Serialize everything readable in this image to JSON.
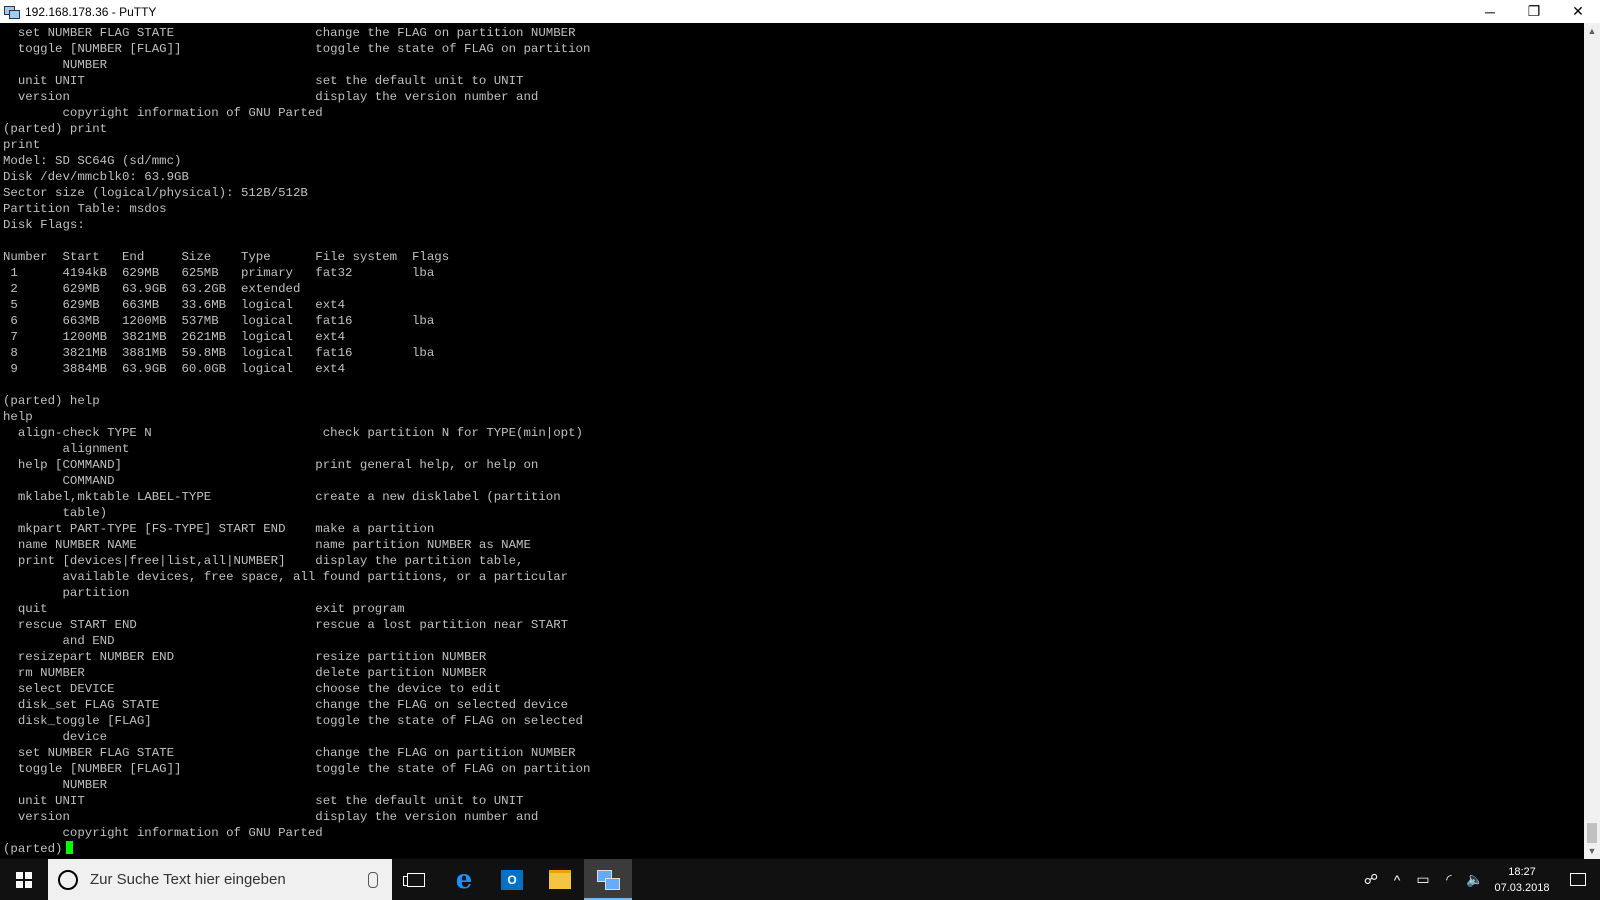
{
  "window": {
    "title": "192.168.178.36 - PuTTY",
    "controls": {
      "minimize": "─",
      "maximize": "❐",
      "close": "✕"
    }
  },
  "terminal": {
    "lines": [
      "  set NUMBER FLAG STATE                   change the FLAG on partition NUMBER",
      "  toggle [NUMBER [FLAG]]                  toggle the state of FLAG on partition",
      "        NUMBER",
      "  unit UNIT                               set the default unit to UNIT",
      "  version                                 display the version number and",
      "        copyright information of GNU Parted",
      "(parted) print",
      "print",
      "Model: SD SC64G (sd/mmc)",
      "Disk /dev/mmcblk0: 63.9GB",
      "Sector size (logical/physical): 512B/512B",
      "Partition Table: msdos",
      "Disk Flags:",
      "",
      "Number  Start   End     Size    Type      File system  Flags",
      " 1      4194kB  629MB   625MB   primary   fat32        lba",
      " 2      629MB   63.9GB  63.2GB  extended",
      " 5      629MB   663MB   33.6MB  logical   ext4",
      " 6      663MB   1200MB  537MB   logical   fat16        lba",
      " 7      1200MB  3821MB  2621MB  logical   ext4",
      " 8      3821MB  3881MB  59.8MB  logical   fat16        lba",
      " 9      3884MB  63.9GB  60.0GB  logical   ext4",
      "",
      "(parted) help",
      "help",
      "  align-check TYPE N                       check partition N for TYPE(min|opt)",
      "        alignment",
      "  help [COMMAND]                          print general help, or help on",
      "        COMMAND",
      "  mklabel,mktable LABEL-TYPE              create a new disklabel (partition",
      "        table)",
      "  mkpart PART-TYPE [FS-TYPE] START END    make a partition",
      "  name NUMBER NAME                        name partition NUMBER as NAME",
      "  print [devices|free|list,all|NUMBER]    display the partition table,",
      "        available devices, free space, all found partitions, or a particular",
      "        partition",
      "  quit                                    exit program",
      "  rescue START END                        rescue a lost partition near START",
      "        and END",
      "  resizepart NUMBER END                   resize partition NUMBER",
      "  rm NUMBER                               delete partition NUMBER",
      "  select DEVICE                           choose the device to edit",
      "  disk_set FLAG STATE                     change the FLAG on selected device",
      "  disk_toggle [FLAG]                      toggle the state of FLAG on selected",
      "        device",
      "  set NUMBER FLAG STATE                   change the FLAG on partition NUMBER",
      "  toggle [NUMBER [FLAG]]                  toggle the state of FLAG on partition",
      "        NUMBER",
      "  unit UNIT                               set the default unit to UNIT",
      "  version                                 display the version number and",
      "        copyright information of GNU Parted"
    ],
    "prompt": "(parted)",
    "colors": {
      "background": "#000000",
      "text": "#c0c0c0",
      "cursor": "#00ff00"
    }
  },
  "taskbar": {
    "search_placeholder": "Zur Suche Text hier eingeben",
    "apps": [
      {
        "name": "task-view",
        "icon": "taskview-icon"
      },
      {
        "name": "edge",
        "icon": "edge-icon",
        "glyph": "e"
      },
      {
        "name": "outlook",
        "icon": "outlook-icon",
        "glyph": "O"
      },
      {
        "name": "file-explorer",
        "icon": "folder-icon"
      },
      {
        "name": "putty",
        "icon": "putty-icon",
        "active": true
      }
    ],
    "tray": {
      "people": "☍",
      "chevron": "^",
      "battery": "▭",
      "wifi": "◜",
      "volume": "🔈",
      "time": "18:27",
      "date": "07.03.2018"
    }
  }
}
